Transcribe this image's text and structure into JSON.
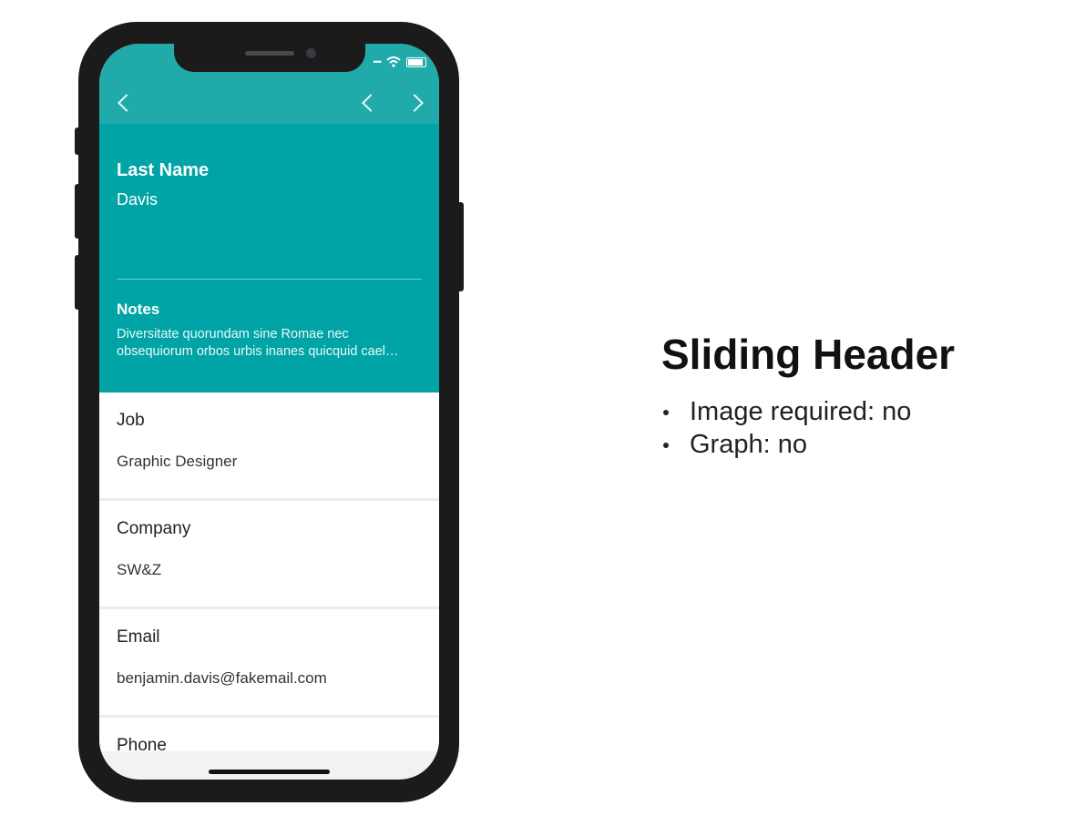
{
  "app": {
    "header": {
      "last_name_label": "Last Name",
      "last_name_value": "Davis",
      "notes_label": "Notes",
      "notes_line1": "Diversitate quorundam sine Romae nec",
      "notes_line2": "obsequiorum orbos urbis inanes quicquid cael…"
    },
    "fields": [
      {
        "label": "Job",
        "value": "Graphic Designer"
      },
      {
        "label": "Company",
        "value": "SW&Z"
      },
      {
        "label": "Email",
        "value": "benjamin.davis@fakemail.com"
      },
      {
        "label": "Phone",
        "value": ""
      }
    ],
    "nav_icons": [
      "chevron-left-icon",
      "chevron-left-icon",
      "chevron-right-icon"
    ]
  },
  "description": {
    "title": "Sliding Header",
    "bullets": [
      "Image required: no",
      "Graph: no"
    ]
  },
  "colors": {
    "header_teal": "#00a4a6",
    "topbar_teal": "#21aaaa",
    "phone_frame": "#1b1b1b"
  }
}
